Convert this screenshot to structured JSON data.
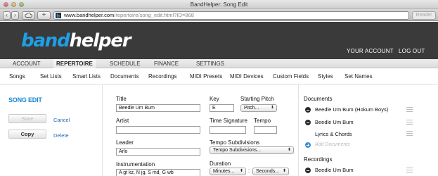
{
  "window": {
    "title": "BandHelper: Song Edit"
  },
  "browser": {
    "url_host": "www.bandhelper.com",
    "url_path": "/repertoire/song_edit.html?ID=868",
    "reader_label": "Reader",
    "back_icon": "chevron-left-icon",
    "forward_icon": "chevron-right-icon",
    "cloud_icon": "cloud-icon",
    "add_icon": "plus-icon"
  },
  "brand": {
    "part1": "band",
    "part2": "helper",
    "accent": "#1e9fe6"
  },
  "header_links": {
    "account": "YOUR ACCOUNT",
    "logout": "LOG OUT"
  },
  "main_nav": {
    "items": [
      "ACCOUNT",
      "REPERTOIRE",
      "SCHEDULE",
      "FINANCE",
      "SETTINGS"
    ],
    "active": "REPERTOIRE"
  },
  "sub_nav": {
    "items": [
      "Songs",
      "Set Lists",
      "Smart Lists",
      "Documents",
      "Recordings",
      "MIDI Presets",
      "MIDI Devices",
      "Custom Fields",
      "Styles",
      "Set Names"
    ]
  },
  "sidebar": {
    "title": "SONG EDIT",
    "save": "Save",
    "cancel": "Cancel",
    "copy": "Copy",
    "delete": "Delete"
  },
  "form": {
    "title_label": "Title",
    "title_value": "Beedle Um Bum",
    "artist_label": "Artist",
    "artist_value": "",
    "leader_label": "Leader",
    "leader_value": "Arlo",
    "instrumentation_label": "Instrumentation",
    "instrumentation_value": "A gt kz, N jg, S md, G wb",
    "key_label": "Key",
    "key_value": "E",
    "starting_pitch_label": "Starting Pitch",
    "starting_pitch_value": "Pitch...",
    "time_signature_label": "Time Signature",
    "time_signature_value": "",
    "tempo_label": "Tempo",
    "tempo_value": "",
    "tempo_subdivisions_label": "Tempo Subdivisions",
    "tempo_subdivisions_value": "Tempo Subdivisions...",
    "duration_label": "Duration",
    "duration_minutes": "Minutes...",
    "duration_seconds": "Seconds...",
    "duration_sep": ":"
  },
  "documents": {
    "title": "Documents",
    "items": [
      "Beedle Um Bum (Hokum Boys)",
      "Beedle Um Bum",
      "Lyrics & Chords"
    ],
    "add_label": "Add Documents"
  },
  "recordings": {
    "title": "Recordings",
    "items": [
      "Beedle Um Bum"
    ]
  }
}
